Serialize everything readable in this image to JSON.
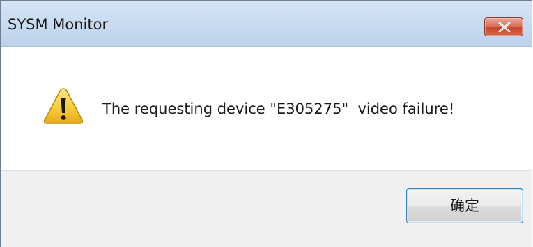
{
  "window": {
    "title": "SYSM Monitor",
    "close_icon": "close-icon"
  },
  "message": {
    "icon": "warning-icon",
    "text": "The requesting device \"E305275\"  video failure!"
  },
  "buttons": {
    "ok_label": "确定"
  },
  "colors": {
    "titlebar": "#c9dcf1",
    "close_button": "#c7452d",
    "footer": "#f0f0f0",
    "ok_border": "#3c7fb1",
    "warning_yellow": "#f6c933"
  }
}
